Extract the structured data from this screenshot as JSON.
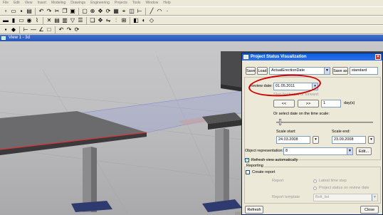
{
  "menubar": {
    "items": [
      "File",
      "Edit",
      "View",
      "Insert",
      "Modeling",
      "Drawings",
      "Engineering",
      "Projects",
      "Tools",
      "Window",
      "Help"
    ]
  },
  "toolbars": {
    "icon_names": [
      "new-icon",
      "open-icon",
      "save-icon",
      "print-icon",
      "undo-icon",
      "redo-icon",
      "cut-icon",
      "copy-icon",
      "paste-icon",
      "select-icon",
      "zoom-icon",
      "pan-icon",
      "rotate-icon",
      "grid-icon",
      "snap-icon",
      "layer-icon",
      "measure-icon"
    ]
  },
  "view": {
    "title": "View 1 - 3d"
  },
  "dialog": {
    "title": "Project Status Visualization",
    "save_label": "Save",
    "load_label": "Load",
    "preset_value": "ActualErectionDate",
    "save_as_label": "Save as",
    "save_as_value": "standard",
    "review_date_label": "Review date:",
    "review_date_value": "01.05.2011",
    "step_label": "Step backward or forward:",
    "back_label": "<<",
    "forward_label": ">>",
    "step_value": "1",
    "step_unit": "day(s)",
    "scale_hint": "Or select date on the time scale:",
    "scale_start_label": "Scale start:",
    "scale_start_value": "24.03.2008",
    "scale_end_label": "Scale end:",
    "scale_end_value": "23.09.2008",
    "object_repr_label": "Object representation:",
    "object_repr_value": "8",
    "edit_label": "Edit...",
    "refresh_auto_label": "Refresh view automatically",
    "reporting_label": "Reporting",
    "create_report_label": "Create report",
    "report_label": "Report",
    "latest_time_step_label": "Latest time step",
    "project_status_label": "Project status on review date",
    "report_template_label": "Report template",
    "report_template_value": "Bolt_list",
    "refresh_label": "Refresh",
    "close_label": "Close"
  },
  "colors": {
    "highlight_circle": "#d10000",
    "dialog_title": "#0a5fd8",
    "viewport_bg": "#bfbfc1"
  }
}
